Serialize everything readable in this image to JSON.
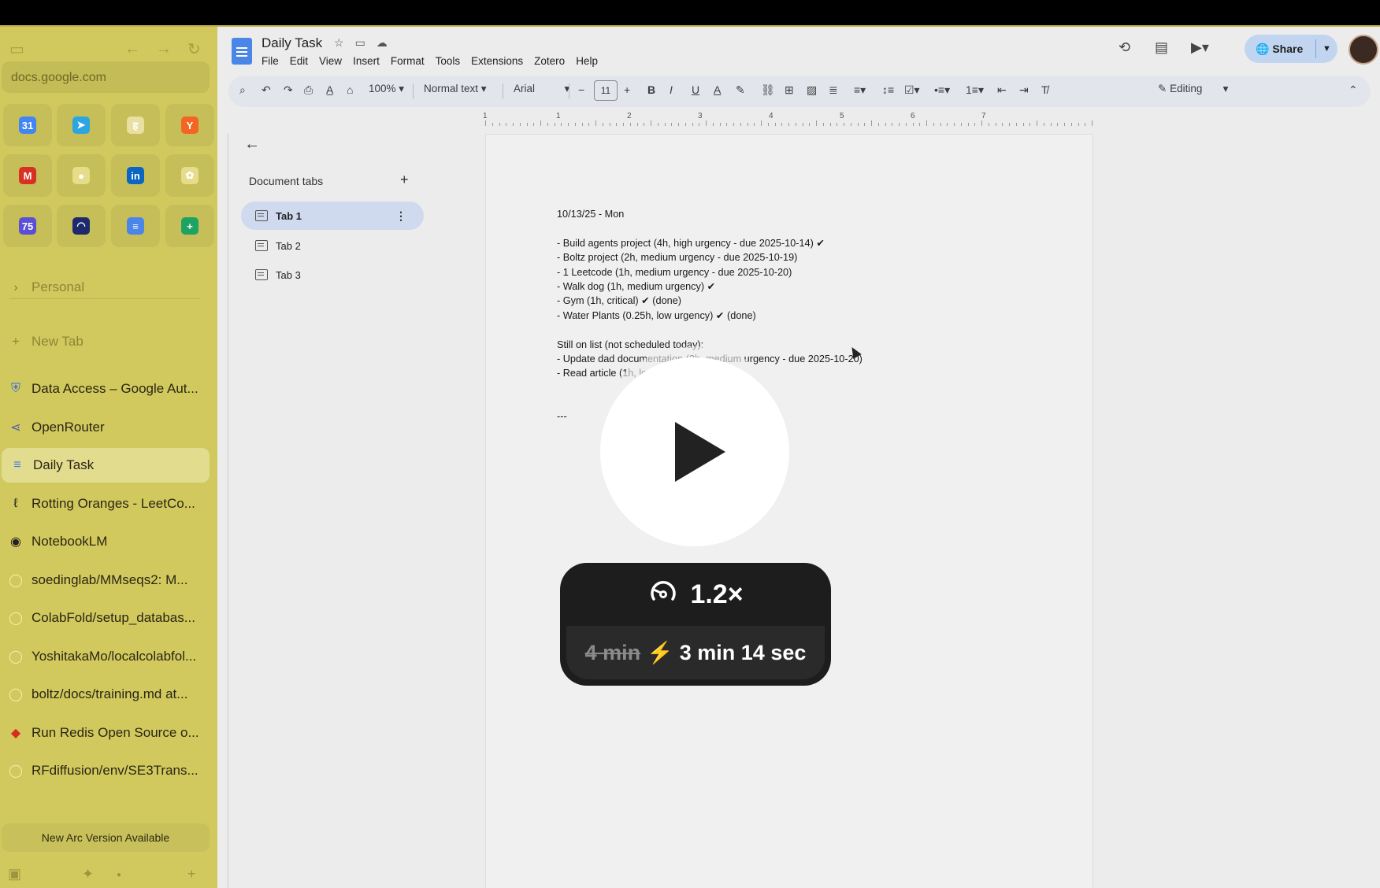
{
  "browser": {
    "url": "docs.google.com",
    "favorites": [
      {
        "icon": "calendar-icon",
        "glyph": "31",
        "color": "#4285f4"
      },
      {
        "icon": "telegram-icon",
        "glyph": "➤",
        "color": "#2ca5e0"
      },
      {
        "icon": "app-icon",
        "glyph": "ह",
        "color": "#e8dfa0"
      },
      {
        "icon": "ycombinator-icon",
        "glyph": "Y",
        "color": "#f26522"
      },
      {
        "icon": "gmail-icon",
        "glyph": "M",
        "color": "#d93025"
      },
      {
        "icon": "github-icon",
        "glyph": "●",
        "color": "#e6dc8a"
      },
      {
        "icon": "linkedin-icon",
        "glyph": "in",
        "color": "#0a66c2"
      },
      {
        "icon": "chatgpt-icon",
        "glyph": "✿",
        "color": "#e6dc8a"
      },
      {
        "icon": "calendar-75-icon",
        "glyph": "75",
        "color": "#5b4fd6"
      },
      {
        "icon": "dashboard-icon",
        "glyph": "◠",
        "color": "#1e2a6b"
      },
      {
        "icon": "docs-icon",
        "glyph": "≡",
        "color": "#4a86e8"
      },
      {
        "icon": "sheets-icon",
        "glyph": "+",
        "color": "#1ea362"
      }
    ],
    "folder_label": "Personal",
    "new_tab_label": "New Tab",
    "tabs": [
      {
        "label": "Data Access – Google Aut...",
        "icon": "shield-icon"
      },
      {
        "label": "OpenRouter",
        "icon": "openrouter-icon"
      },
      {
        "label": "Daily Task",
        "icon": "docs-icon"
      },
      {
        "label": "Rotting Oranges - LeetCo...",
        "icon": "leetcode-icon"
      },
      {
        "label": "NotebookLM",
        "icon": "notebooklm-icon"
      },
      {
        "label": "soedinglab/MMseqs2: M...",
        "icon": "github-icon"
      },
      {
        "label": "ColabFold/setup_databas...",
        "icon": "github-icon"
      },
      {
        "label": "YoshitakaMo/localcolabfol...",
        "icon": "github-icon"
      },
      {
        "label": "boltz/docs/training.md at...",
        "icon": "github-icon"
      },
      {
        "label": "Run Redis Open Source o...",
        "icon": "redis-icon"
      },
      {
        "label": "RFdiffusion/env/SE3Trans...",
        "icon": "github-icon"
      }
    ],
    "update_notice": "New Arc Version Available"
  },
  "docs": {
    "title": "Daily Task",
    "menu": [
      "File",
      "Edit",
      "View",
      "Insert",
      "Format",
      "Tools",
      "Extensions",
      "Zotero",
      "Help"
    ],
    "share_label": "Share",
    "toolbar": {
      "zoom": "100%",
      "style": "Normal text",
      "font": "Arial",
      "font_size": "11",
      "mode": "Editing"
    },
    "ruler_numbers": [
      "1",
      "1",
      "2",
      "3",
      "4",
      "5",
      "6",
      "7"
    ],
    "doc_tabs_header": "Document tabs",
    "doc_tabs": [
      "Tab 1",
      "Tab 2",
      "Tab 3"
    ],
    "body_lines": [
      "10/13/25 - Mon",
      "",
      "- Build agents project (4h, high urgency - due 2025-10-14) ✔",
      "- Boltz project (2h, medium urgency - due 2025-10-19)",
      "- 1 Leetcode (1h, medium urgency - due 2025-10-20)",
      "- Walk dog (1h, medium urgency) ✔",
      "- Gym (1h, critical) ✔ (done)",
      "- Water Plants (0.25h, low urgency) ✔ (done)",
      "",
      "Still on list (not scheduled today):",
      "- Update dad documentation (3h, medium urgency - due 2025-10-20)",
      "- Read article (1h, lo",
      "",
      "",
      "---"
    ]
  },
  "overlay": {
    "speed": "1.2×",
    "original_time": "4 min",
    "new_time": "3 min 14 sec"
  }
}
